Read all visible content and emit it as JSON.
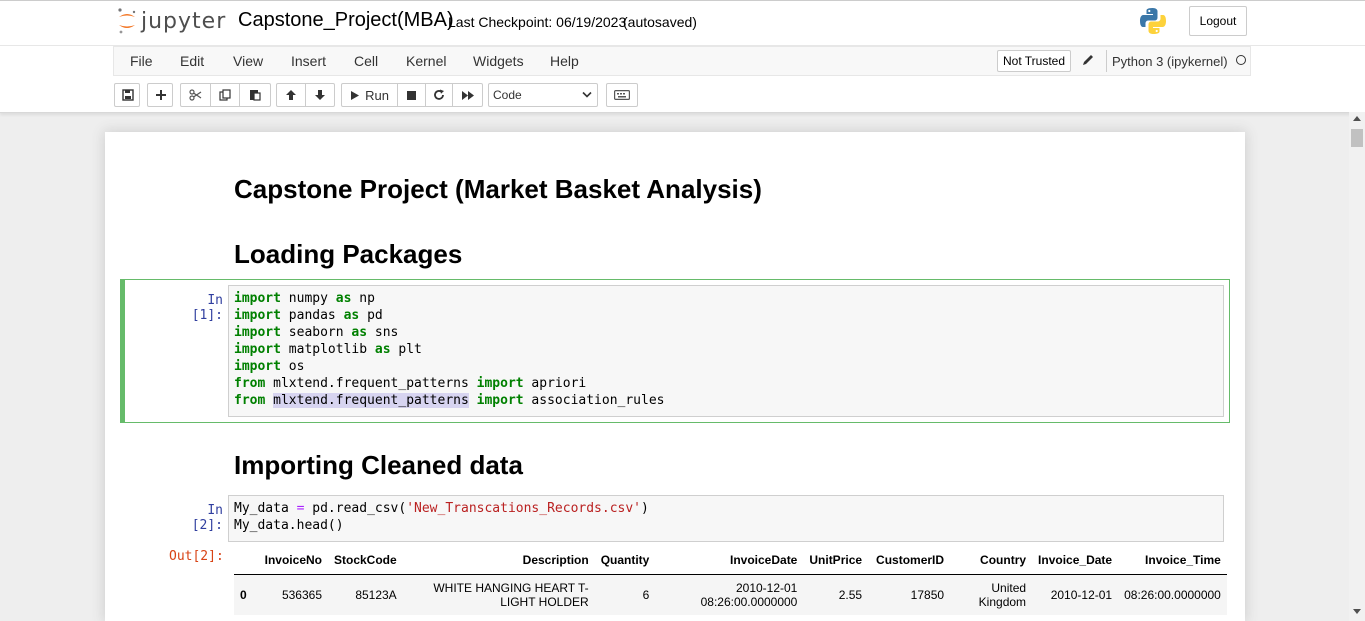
{
  "header": {
    "logo_text": "jupyter",
    "notebook_title": "Capstone_Project(MBA)",
    "checkpoint": "Last Checkpoint: 06/19/2023",
    "autosave_status": "(autosaved)",
    "logout_label": "Logout"
  },
  "menubar": {
    "items": [
      "File",
      "Edit",
      "View",
      "Insert",
      "Cell",
      "Kernel",
      "Widgets",
      "Help"
    ],
    "trust_label": "Not Trusted",
    "kernel_name": "Python 3 (ipykernel)"
  },
  "toolbar": {
    "run_label": "Run",
    "cell_type": "Code"
  },
  "notebook": {
    "heading_1": "Capstone Project (Market Basket Analysis)",
    "heading_2": "Loading Packages",
    "cell_1_prompt": "In [1]:",
    "heading_3": "Importing Cleaned data",
    "cell_2_prompt": "In [2]:",
    "out_2_prompt": "Out[2]:",
    "cell_1_code": {
      "kw_import": "import",
      "kw_as": "as",
      "kw_from": "from",
      "l1_mod": " numpy ",
      "l1_alias": " np",
      "l2_mod": " pandas ",
      "l2_alias": " pd",
      "l3_mod": " seaborn ",
      "l3_alias": " sns",
      "l4_mod": " matplotlib ",
      "l4_alias": " plt",
      "l5_mod": " os",
      "l6_mod": " mlxtend.frequent_patterns ",
      "l6_name": " apriori",
      "l7_mod": "mlxtend.frequent_patterns",
      "l7_name": " association_rules"
    },
    "cell_2_code": {
      "l1_a": "My_data ",
      "l1_eq": "=",
      "l1_b": " pd.read_csv(",
      "l1_str": "'New_Transcations_Records.csv'",
      "l1_c": ")",
      "l2": "My_data.head()"
    },
    "table": {
      "columns": [
        "",
        "InvoiceNo",
        "StockCode",
        "Description",
        "Quantity",
        "InvoiceDate",
        "UnitPrice",
        "CustomerID",
        "Country",
        "Invoice_Date",
        "Invoice_Time"
      ],
      "rows": [
        {
          "index": "0",
          "InvoiceNo": "536365",
          "StockCode": "85123A",
          "Description_1": "WHITE HANGING HEART T-",
          "Description_2": "LIGHT HOLDER",
          "Quantity": "6",
          "InvoiceDate_1": "2010-12-01",
          "InvoiceDate_2": "08:26:00.0000000",
          "UnitPrice": "2.55",
          "CustomerID": "17850",
          "Country_1": "United",
          "Country_2": "Kingdom",
          "Invoice_Date": "2010-12-01",
          "Invoice_Time": "08:26:00.0000000"
        }
      ]
    }
  },
  "colors": {
    "selected_cell_border": "#66bb6a",
    "in_prompt": "#303f9f",
    "out_prompt": "#d84315",
    "keyword": "#008000",
    "string": "#ba2121",
    "operator": "#aa22ff"
  }
}
